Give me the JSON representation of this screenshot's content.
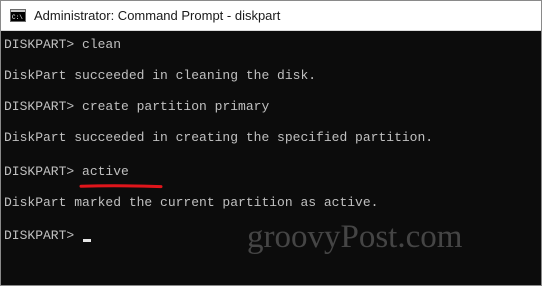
{
  "window": {
    "title": "Administrator: Command Prompt - diskpart",
    "icon": "command-prompt-icon"
  },
  "console": {
    "lines": [
      {
        "prompt": "DISKPART> ",
        "command": "clean"
      },
      {
        "text": "DiskPart succeeded in cleaning the disk."
      },
      {
        "prompt": "DISKPART> ",
        "command": "create partition primary"
      },
      {
        "text": "DiskPart succeeded in creating the specified partition."
      },
      {
        "prompt": "DISKPART> ",
        "command": "active"
      },
      {
        "text": "DiskPart marked the current partition as active."
      },
      {
        "prompt": "DISKPART> ",
        "command": ""
      }
    ]
  },
  "annotation": {
    "highlighted_command": "active",
    "color": "#e0151b"
  },
  "watermark": "groovyPost.com",
  "colors": {
    "console_bg": "#0c0c0c",
    "console_text": "#c0c0c0",
    "titlebar_bg": "#ffffff"
  }
}
